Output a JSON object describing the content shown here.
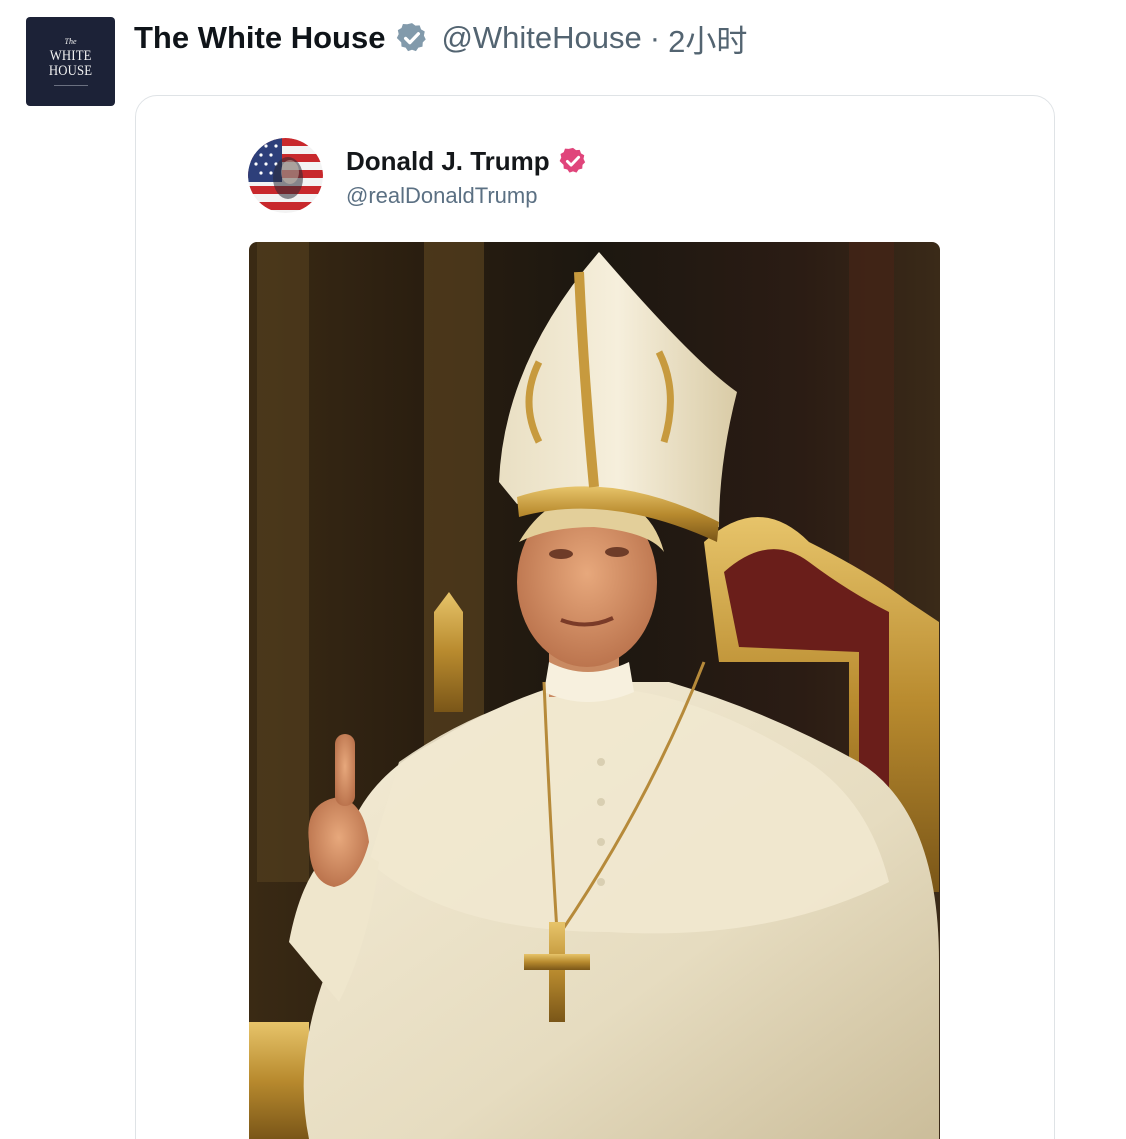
{
  "post": {
    "author": {
      "display_name": "The White House",
      "handle": "@WhiteHouse",
      "separator": "·",
      "time": "2小时",
      "verified": "gray-verified-badge",
      "avatar": {
        "line1": "The",
        "line2": "WHITE",
        "line3": "HOUSE",
        "background": "#1c2237"
      }
    },
    "quoted": {
      "display_name": "Donald J. Trump",
      "handle": "@realDonaldTrump",
      "verified": "pink-verified-badge",
      "verified_color": "#e0457b",
      "media": "image-of-figure-in-papal-vestments-seated-on-gold-throne"
    }
  },
  "colors": {
    "text_primary": "#0f1419",
    "text_secondary": "#536471",
    "card_border": "#dfe3e6",
    "badge_gray": "#829aab"
  }
}
